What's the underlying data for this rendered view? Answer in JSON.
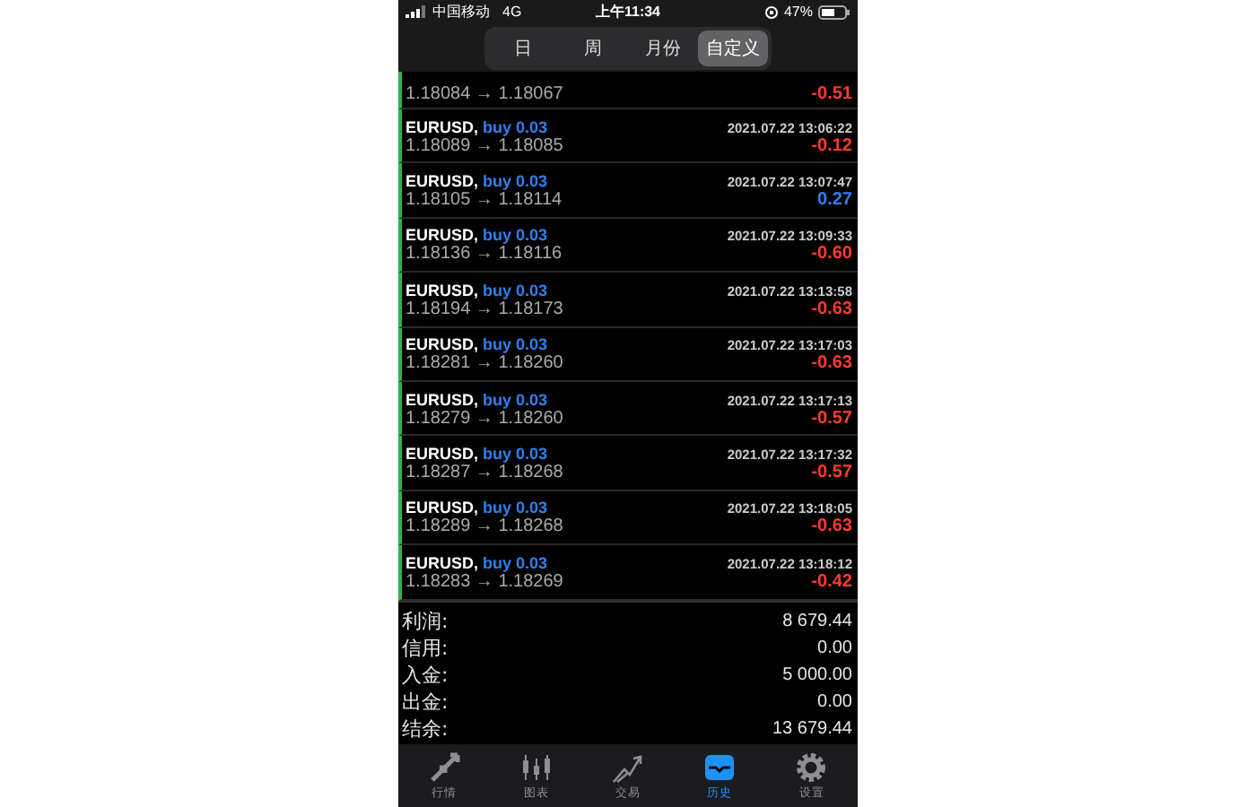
{
  "status_bar": {
    "carrier": "中国移动",
    "network": "4G",
    "time": "上午11:34",
    "battery": "47%"
  },
  "periods": [
    {
      "label": "日",
      "selected": false
    },
    {
      "label": "周",
      "selected": false
    },
    {
      "label": "月份",
      "selected": false
    },
    {
      "label": "自定义",
      "selected": true
    }
  ],
  "deals": [
    {
      "prices": "1.18084 → 1.18067",
      "profit": "-0.51",
      "color": "#ff3b30"
    },
    {
      "symbol": "EURUSD,",
      "side": "buy 0.03",
      "time": "2021.07.22 13:06:22",
      "prices": "1.18089 → 1.18085",
      "profit": "-0.12",
      "color": "#ff3b30"
    },
    {
      "symbol": "EURUSD,",
      "side": "buy 0.03",
      "time": "2021.07.22 13:07:47",
      "prices": "1.18105 → 1.18114",
      "profit": "0.27",
      "color": "#2f80ed"
    },
    {
      "symbol": "EURUSD,",
      "side": "buy 0.03",
      "time": "2021.07.22 13:09:33",
      "prices": "1.18136 → 1.18116",
      "profit": "-0.60",
      "color": "#ff3b30"
    },
    {
      "symbol": "EURUSD,",
      "side": "buy 0.03",
      "time": "2021.07.22 13:13:58",
      "prices": "1.18194 → 1.18173",
      "profit": "-0.63",
      "color": "#ff3b30"
    },
    {
      "symbol": "EURUSD,",
      "side": "buy 0.03",
      "time": "2021.07.22 13:17:03",
      "prices": "1.18281 → 1.18260",
      "profit": "-0.63",
      "color": "#ff3b30"
    },
    {
      "symbol": "EURUSD,",
      "side": "buy 0.03",
      "time": "2021.07.22 13:17:13",
      "prices": "1.18279 → 1.18260",
      "profit": "-0.57",
      "color": "#ff3b30"
    },
    {
      "symbol": "EURUSD,",
      "side": "buy 0.03",
      "time": "2021.07.22 13:17:32",
      "prices": "1.18287 → 1.18268",
      "profit": "-0.57",
      "color": "#ff3b30"
    },
    {
      "symbol": "EURUSD,",
      "side": "buy 0.03",
      "time": "2021.07.22 13:18:05",
      "prices": "1.18289 → 1.18268",
      "profit": "-0.63",
      "color": "#ff3b30"
    },
    {
      "symbol": "EURUSD,",
      "side": "buy 0.03",
      "time": "2021.07.22 13:18:12",
      "prices": "1.18283 → 1.18269",
      "profit": "-0.42",
      "color": "#ff3b30"
    }
  ],
  "summary": [
    {
      "label": "利润:",
      "value": "8 679.44"
    },
    {
      "label": "信用:",
      "value": "0.00"
    },
    {
      "label": "入金:",
      "value": "5 000.00"
    },
    {
      "label": "出金:",
      "value": "0.00"
    },
    {
      "label": "结余:",
      "value": "13 679.44"
    }
  ],
  "tabs": [
    {
      "label": "行情",
      "kind": "quotes",
      "selected": false
    },
    {
      "label": "图表",
      "kind": "chart",
      "selected": false
    },
    {
      "label": "交易",
      "kind": "trade",
      "selected": false
    },
    {
      "label": "历史",
      "kind": "history",
      "selected": true
    },
    {
      "label": "设置",
      "kind": "settings",
      "selected": false
    }
  ]
}
